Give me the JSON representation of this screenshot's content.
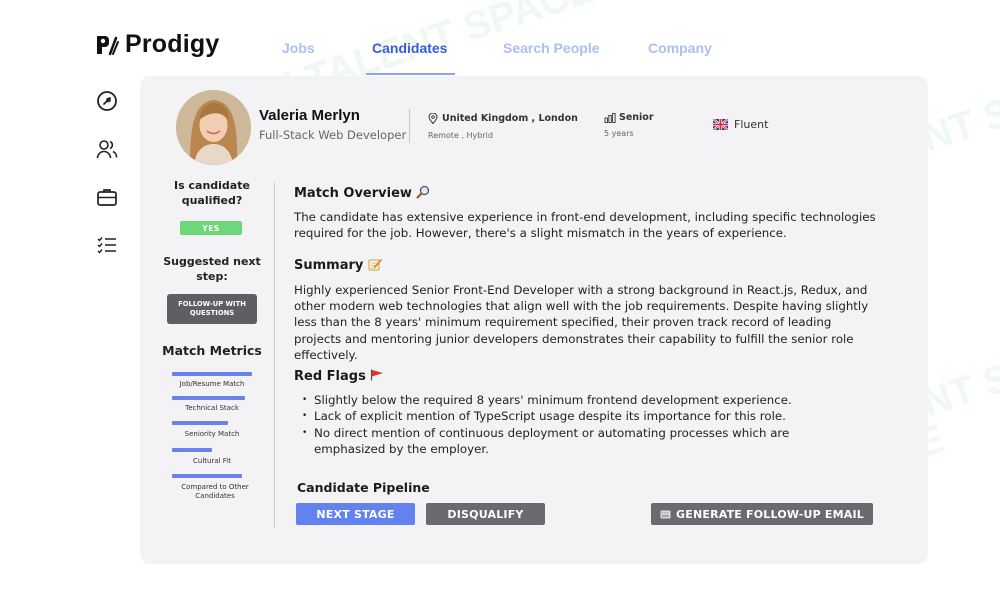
{
  "app": {
    "name": "Prodigy",
    "watermark": "AI TALENT SPACE"
  },
  "nav": {
    "tabs": [
      {
        "label": "Jobs"
      },
      {
        "label": "Candidates"
      },
      {
        "label": "Search People"
      },
      {
        "label": "Company"
      }
    ],
    "active": "Candidates"
  },
  "sidebar": {
    "icons": [
      "dashboard-icon",
      "users-icon",
      "briefcase-icon",
      "checklist-icon"
    ]
  },
  "candidate": {
    "name": "Valeria Merlyn",
    "role": "Full-Stack Web Developer",
    "location": "United Kingdom , London",
    "work_mode": "Remote , Hybrid",
    "seniority": "Senior",
    "experience": "5 years",
    "language": "Fluent"
  },
  "qualification": {
    "title": "Is candidate qualified?",
    "status": "YES",
    "status_color": "#6fd67a",
    "next_step_title": "Suggested next step:",
    "next_step_button": "FOLLOW-UP WITH QUESTIONS"
  },
  "match_metrics": {
    "title": "Match Metrics",
    "items": [
      {
        "label": "Job/Resume Match"
      },
      {
        "label": "Technical Stack"
      },
      {
        "label": "Seniority Match"
      },
      {
        "label": "Cultural Fit"
      },
      {
        "label": "Compared to Other Candidates"
      }
    ]
  },
  "overview": {
    "title": "Match Overview",
    "text": "The candidate has extensive experience in front-end development, including specific technologies required for the job. However, there's a slight mismatch in the years of experience."
  },
  "summary": {
    "title": "Summary",
    "text": "Highly experienced Senior Front-End Developer with a strong background in React.js, Redux, and other modern web technologies that align well with the job requirements. Despite having slightly less than the 8 years' minimum requirement specified, their proven track record of leading projects and mentoring junior developers demonstrates their capability to fulfill the senior role effectively."
  },
  "red_flags": {
    "title": "Red Flags",
    "items": [
      "Slightly below the required 8 years' minimum frontend development experience.",
      "Lack of explicit mention of TypeScript usage despite its importance for this role.",
      "No direct mention of continuous deployment or automating processes which are emphasized by the employer."
    ]
  },
  "pipeline": {
    "title": "Candidate Pipeline",
    "next_stage": "NEXT STAGE",
    "disqualify": "DISQUALIFY",
    "generate_email": "GENERATE FOLLOW-UP EMAIL"
  },
  "colors": {
    "accent": "#6382ef",
    "active_tab": "#3d5bd6",
    "inactive_tab": "#aabff1",
    "panel": "#f3f3f5",
    "neutral_button": "#6a6b6e",
    "flag_red": "#e0322a"
  }
}
